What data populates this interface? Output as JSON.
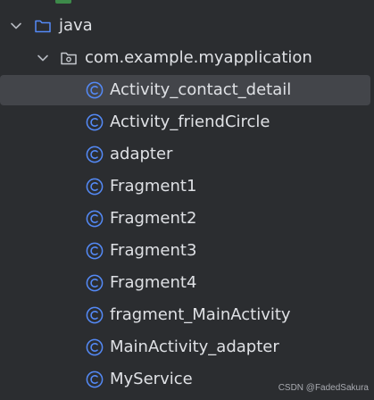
{
  "tree": {
    "java_folder": {
      "label": "java",
      "icon": "folder-icon",
      "expanded": true
    },
    "package": {
      "label": "com.example.myapplication",
      "icon": "package-icon",
      "expanded": true
    },
    "classes": [
      {
        "label": "Activity_contact_detail",
        "icon": "class-icon",
        "selected": true
      },
      {
        "label": "Activity_friendCircle",
        "icon": "class-icon"
      },
      {
        "label": "adapter",
        "icon": "class-icon"
      },
      {
        "label": "Fragment1",
        "icon": "class-icon"
      },
      {
        "label": "Fragment2",
        "icon": "class-icon"
      },
      {
        "label": "Fragment3",
        "icon": "class-icon"
      },
      {
        "label": "Fragment4",
        "icon": "class-icon"
      },
      {
        "label": "fragment_MainActivity",
        "icon": "class-icon"
      },
      {
        "label": "MainActivity_adapter",
        "icon": "class-icon"
      },
      {
        "label": "MyService",
        "icon": "class-icon"
      }
    ]
  },
  "watermark": "CSDN @FadedSakura",
  "colors": {
    "background": "#2b2d30",
    "selection": "#43454a",
    "text": "#dfe1e5",
    "folder_blue": "#548af7",
    "class_blue": "#548af7"
  }
}
